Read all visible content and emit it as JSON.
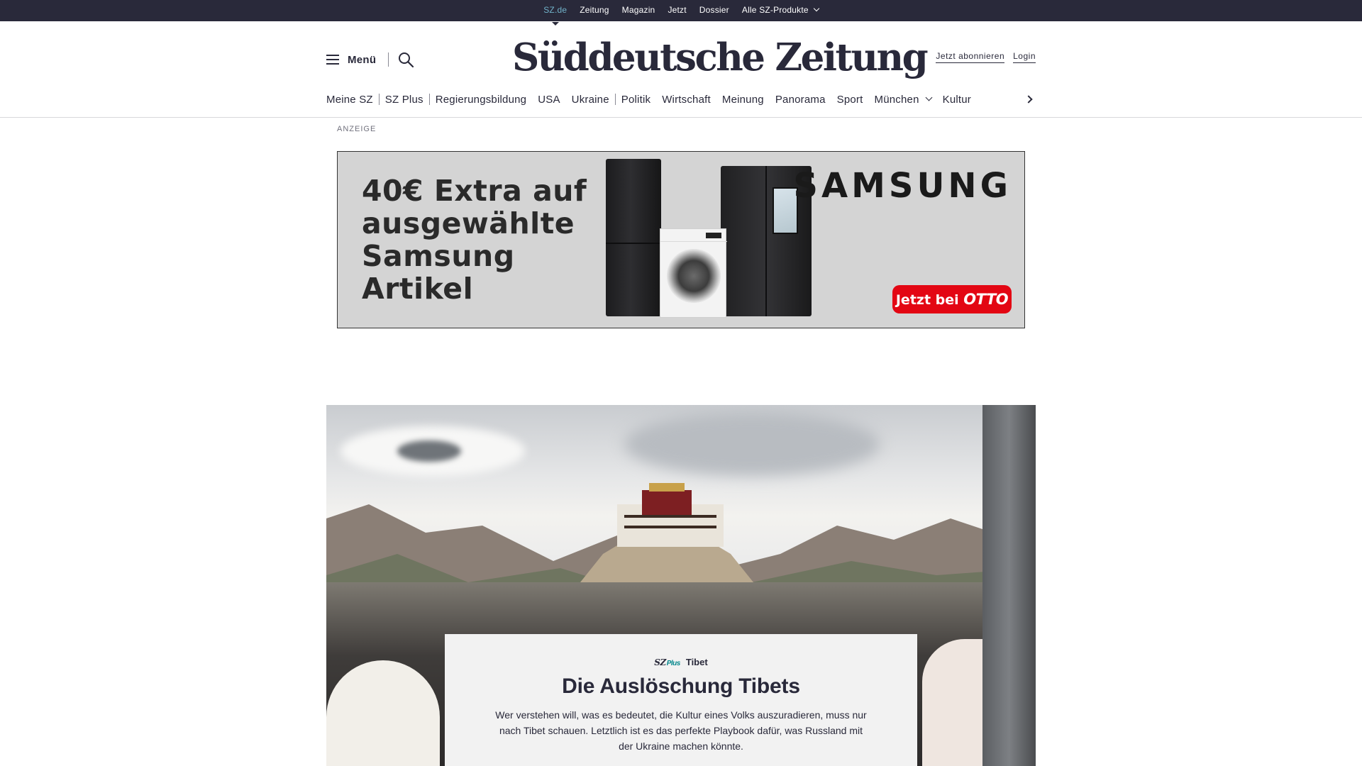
{
  "topbar": {
    "items": [
      {
        "label": "SZ.de"
      },
      {
        "label": "Zeitung"
      },
      {
        "label": "Magazin"
      },
      {
        "label": "Jetzt"
      },
      {
        "label": "Dossier"
      },
      {
        "label": "Alle SZ-Produkte"
      }
    ]
  },
  "header": {
    "menu_label": "Menü",
    "logo": "Süddeutsche Zeitung",
    "subscribe": "Jetzt abonnieren",
    "login": "Login"
  },
  "nav": {
    "items": [
      {
        "label": "Meine SZ"
      },
      {
        "label": "SZ Plus"
      },
      {
        "label": "Regierungsbildung"
      },
      {
        "label": "USA"
      },
      {
        "label": "Ukraine"
      },
      {
        "label": "Politik"
      },
      {
        "label": "Wirtschaft"
      },
      {
        "label": "Meinung"
      },
      {
        "label": "Panorama"
      },
      {
        "label": "Sport"
      },
      {
        "label": "München"
      },
      {
        "label": "Kultur"
      }
    ]
  },
  "ad": {
    "label": "ANZEIGE",
    "headline": "40€ Extra auf ausgewählte Samsung Artikel",
    "brand": "SAMSUNG",
    "cta_prefix": "Jetzt bei",
    "cta_brand": "OTTO"
  },
  "teaser": {
    "badge_sz": "SZ",
    "badge_plus": "Plus",
    "topic": "Tibet",
    "title": "Die Auslöschung Tibets",
    "summary": "Wer verstehen will, was es bedeutet, die Kultur eines Volks auszuradieren, muss nur nach Tibet schauen. Letztlich ist es das perfekte Playbook dafür, was Russland mit der Ukraine machen könnte."
  },
  "colors": {
    "brand_dark": "#29293a",
    "accent_link": "#71b2c9",
    "sz_plus": "#00868b",
    "otto_red": "#e30613"
  }
}
